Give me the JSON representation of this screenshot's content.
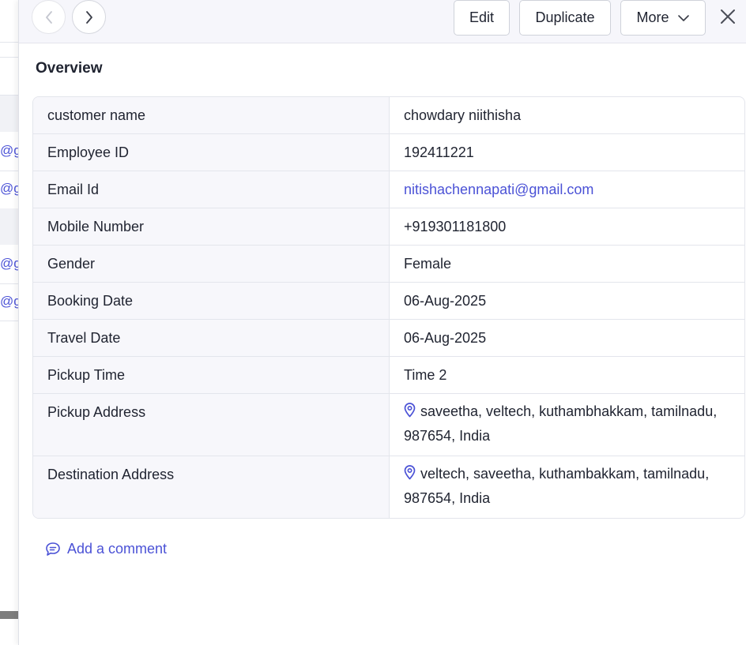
{
  "header": {
    "edit_label": "Edit",
    "duplicate_label": "Duplicate",
    "more_label": "More"
  },
  "overview": {
    "title": "Overview",
    "fields": [
      {
        "label": "customer name",
        "value": "chowdary niithisha"
      },
      {
        "label": "Employee ID",
        "value": "192411221"
      },
      {
        "label": "Email Id",
        "value": "nitishachennapati@gmail.com"
      },
      {
        "label": "Mobile Number",
        "value": "+919301181800"
      },
      {
        "label": "Gender",
        "value": "Female"
      },
      {
        "label": "Booking Date",
        "value": "06-Aug-2025"
      },
      {
        "label": "Travel Date",
        "value": "06-Aug-2025"
      },
      {
        "label": "Pickup Time",
        "value": "Time 2"
      },
      {
        "label": "Pickup Address",
        "value": "saveetha, veltech, kuthambhakkam, tamilnadu, 987654, India"
      },
      {
        "label": "Destination Address",
        "value": "veltech, saveetha, kuthambakkam, tamilnadu, 987654, India"
      }
    ]
  },
  "add_comment_label": "Add a comment",
  "background": {
    "email_fragment": "@g"
  },
  "colors": {
    "accent": "#4b52d6",
    "header_bg": "#f6f6fb",
    "label_bg": "#f7f7fb"
  },
  "icons": [
    "chevron-left-icon",
    "chevron-right-icon",
    "chevron-down-icon",
    "close-icon",
    "location-pin-icon",
    "comment-icon"
  ]
}
